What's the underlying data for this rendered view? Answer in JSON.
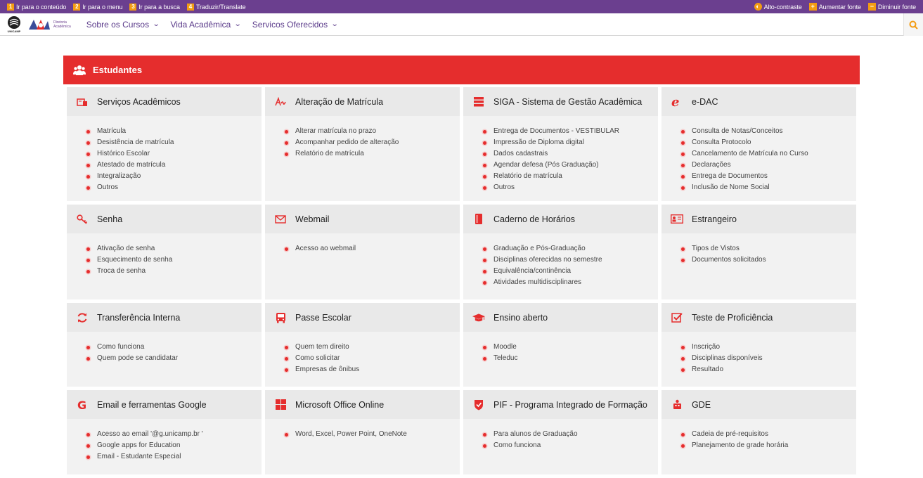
{
  "access_bar": {
    "links": [
      {
        "num": "1",
        "label": "Ir para o conteúdo"
      },
      {
        "num": "2",
        "label": "Ir para o menu"
      },
      {
        "num": "3",
        "label": "Ir para a busca"
      },
      {
        "num": "4",
        "label": "Traduzir/Translate"
      }
    ],
    "contrast": "Alto-contraste",
    "increase_font": "Aumentar fonte",
    "decrease_font": "Diminuir fonte"
  },
  "header": {
    "unicamp_text": "UNICAMP",
    "dac_line1": "Diretoria",
    "dac_line2": "Acadêmica",
    "nav": [
      "Sobre os Cursos",
      "Vida Acadêmica",
      "Servicos Oferecidos"
    ]
  },
  "section": {
    "title": "Estudantes"
  },
  "cards": [
    {
      "title": "Serviços Acadêmicos",
      "icon": "academic-services-icon",
      "items": [
        "Matrícula",
        "Desistência de matrícula",
        "Histórico Escolar",
        "Atestado de matrícula",
        "Integralização",
        "Outros"
      ]
    },
    {
      "title": "Alteração de Matrícula",
      "icon": "signature-icon",
      "items": [
        "Alterar matrícula no prazo",
        "Acompanhar pedido de alteração",
        "Relatório de matrícula"
      ]
    },
    {
      "title": "SIGA - Sistema de Gestão Acadêmica",
      "icon": "server-icon",
      "items": [
        "Entrega de Documentos - VESTIBULAR",
        "Impressão de Diploma digital",
        "Dados cadastrais",
        "Agendar defesa (Pós Graduação)",
        "Relatório de matrícula",
        "Outros"
      ]
    },
    {
      "title": "e-DAC",
      "icon": "edac-icon",
      "items": [
        "Consulta de Notas/Conceitos",
        "Consulta Protocolo",
        "Cancelamento de Matrícula no Curso",
        "Declarações",
        "Entrega de Documentos",
        "Inclusão de Nome Social"
      ]
    },
    {
      "title": "Senha",
      "icon": "key-icon",
      "items": [
        "Ativação de senha",
        "Esquecimento de senha",
        "Troca de senha"
      ]
    },
    {
      "title": "Webmail",
      "icon": "envelope-icon",
      "items": [
        "Acesso ao webmail"
      ]
    },
    {
      "title": "Caderno de Horários",
      "icon": "book-icon",
      "items": [
        "Graduação e Pós-Graduação",
        "Disciplinas oferecidas no semestre",
        "Equivalência/continência",
        "Atividades multidisciplinares"
      ]
    },
    {
      "title": "Estrangeiro",
      "icon": "id-card-icon",
      "items": [
        "Tipos de Vistos",
        "Documentos solicitados"
      ]
    },
    {
      "title": "Transferência Interna",
      "icon": "refresh-icon",
      "items": [
        "Como funciona",
        "Quem pode se candidatar"
      ]
    },
    {
      "title": "Passe Escolar",
      "icon": "bus-icon",
      "items": [
        "Quem tem direito",
        "Como solicitar",
        "Empresas de ônibus"
      ]
    },
    {
      "title": "Ensino aberto",
      "icon": "graduation-cap-icon",
      "items": [
        "Moodle",
        "Teleduc"
      ]
    },
    {
      "title": "Teste de Proficiência",
      "icon": "checkbox-icon",
      "items": [
        "Inscrição",
        "Disciplinas disponíveis",
        "Resultado"
      ]
    },
    {
      "title": "Email e ferramentas Google",
      "icon": "google-icon",
      "items": [
        "Acesso ao email '@g.unicamp.br '",
        "Google apps for Education",
        "Email - Estudante Especial"
      ]
    },
    {
      "title": "Microsoft Office Online",
      "icon": "windows-icon",
      "items": [
        "Word, Excel, Power Point, OneNote"
      ]
    },
    {
      "title": "PIF - Programa Integrado de Formação",
      "icon": "shield-check-icon",
      "items": [
        "Para alunos de Graduação",
        "Como funciona"
      ]
    },
    {
      "title": "GDE",
      "icon": "gde-icon",
      "items": [
        "Cadeia de pré-requisitos",
        "Planejamento de grade horária"
      ]
    }
  ],
  "colors": {
    "accent_red": "#e52d2d",
    "top_bar_purple": "#6b3f8f",
    "nav_purple": "#5a3a8a",
    "badge_orange": "#f39c12"
  }
}
